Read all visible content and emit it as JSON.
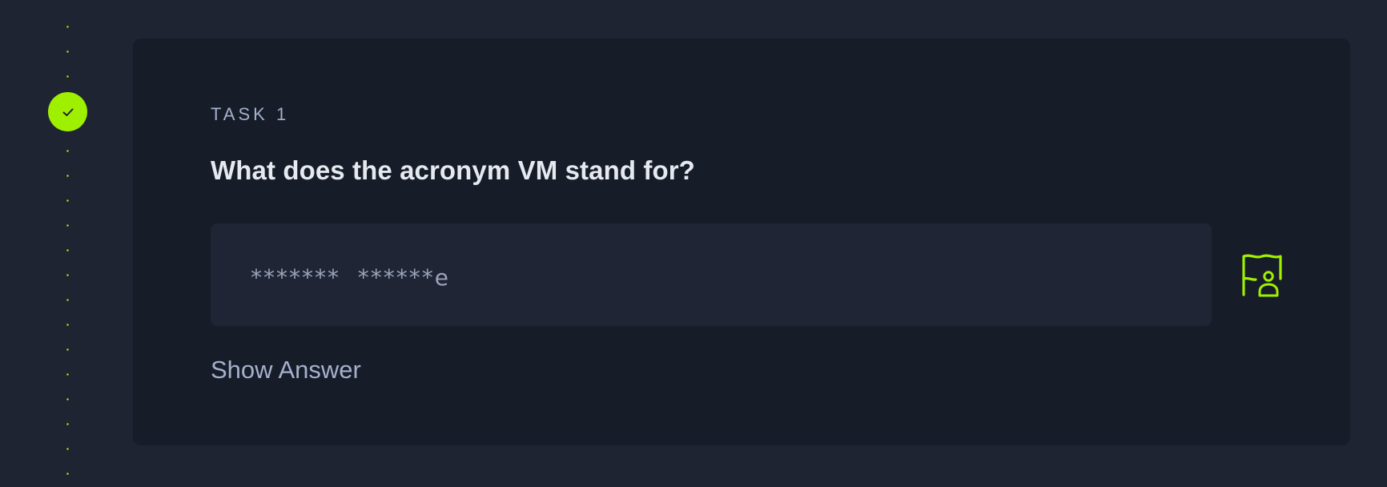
{
  "colors": {
    "background": "#1e2431",
    "card": "#161c28",
    "accent": "#9fef00",
    "answer_box": "#1f2534"
  },
  "timeline": {
    "status": "completed",
    "icon": "check-icon"
  },
  "task": {
    "label": "TASK 1",
    "question": "What does the acronym VM stand for?",
    "answer_masked": "*******  ******e",
    "submit_icon": "flag-user-icon",
    "show_answer_label": "Show Answer"
  }
}
